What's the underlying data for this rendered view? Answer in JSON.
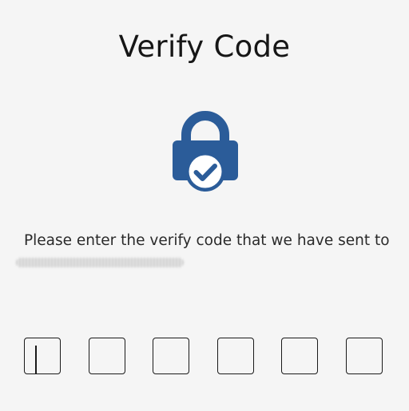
{
  "header": {
    "title": "Verify Code"
  },
  "hero": {
    "icon": "lock-check-icon",
    "icon_color": "#2b5c99"
  },
  "instruction": {
    "text": "Please enter the verify code that we have sent to"
  },
  "code_input": {
    "length": 6,
    "digits": [
      "",
      "",
      "",
      "",
      "",
      ""
    ],
    "focused_index": 0
  }
}
